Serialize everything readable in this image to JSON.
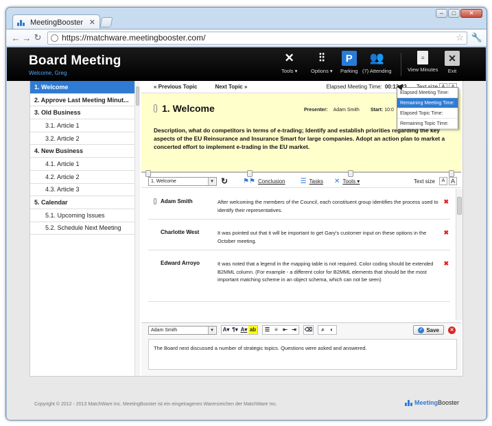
{
  "browser": {
    "tab_title": "MeetingBooster",
    "url": "https://matchware.meetingbooster.com/"
  },
  "app": {
    "title": "Board Meeting",
    "welcome": "Welcome, Greg",
    "toolbar": {
      "tools": "Tools ▾",
      "options": "Options ▾",
      "parking": "Parking",
      "attending": "(7) Attending",
      "view_minutes": "View Minutes",
      "exit": "Exit",
      "parking_glyph": "P"
    }
  },
  "agenda": [
    {
      "label": "1. Welcome",
      "level": "top",
      "active": true
    },
    {
      "label": "2. Approve Last Meeting Minut...",
      "level": "top"
    },
    {
      "label": "3. Old Business",
      "level": "top"
    },
    {
      "label": "3.1. Article 1",
      "level": "sub"
    },
    {
      "label": "3.2. Article 2",
      "level": "sub"
    },
    {
      "label": "4. New Business",
      "level": "top"
    },
    {
      "label": "4.1. Article 1",
      "level": "sub"
    },
    {
      "label": "4.2. Article 2",
      "level": "sub"
    },
    {
      "label": "4.3. Article 3",
      "level": "sub"
    },
    {
      "label": "5. Calendar",
      "level": "top"
    },
    {
      "label": "5.1. Upcoming Issues",
      "level": "sub"
    },
    {
      "label": "5.2. Schedule Next Meeting",
      "level": "sub"
    }
  ],
  "topnav": {
    "prev": "Previous Topic",
    "next": "Next Topic",
    "elapsed_label": "Elapsed Meeting Time:",
    "elapsed_value": "00:12:33",
    "text_size": "Text size",
    "font_a": "A"
  },
  "timer_menu": [
    {
      "label": "Elapsed Meeting Time:"
    },
    {
      "label": "Remaining Meeting Time:",
      "selected": true
    },
    {
      "label": "Elapsed Topic Time:"
    },
    {
      "label": "Remaining Topic Time:"
    }
  ],
  "topic": {
    "title": "1. Welcome",
    "presenter_label": "Presenter:",
    "presenter": "Adam Smith",
    "start_label": "Start:",
    "start_value": "10:0",
    "description": "Description, what do competitors in terms of e-trading; Identify and establish priorities regarding the key aspects of the EU Reinsurance and Insurance Smart for large companies. Adopt an action plan to market a concerted effort to implement e-trading in the EU market."
  },
  "notesbar": {
    "topic_select": "1. Welcome",
    "conclusion": "Conclusion",
    "tasks": "Tasks",
    "tools": "Tools ▾",
    "text_size": "Text size"
  },
  "notes": [
    {
      "name": "Adam Smith",
      "text": "After welcoming the members of the Council, each constituent group identifies the process used to identify their representatives."
    },
    {
      "name": "Charlotte West",
      "text": "It was pointed out that it will be important to get Gary's customer input on these options in the October meeting."
    },
    {
      "name": "Edward Arroyo",
      "text": "It was noted that a legend in the mapping table is not required. Color coding should be extended B2MML column. (For example - a different color for B2MML elements that should be the most important matching scheme in an object schema, which can not be seen)"
    }
  ],
  "editor": {
    "author": "Adam Smith",
    "save": "Save",
    "text": "The Board next discussed a number of strategic topics. Questions were asked and answered."
  },
  "footer": {
    "copyright": "Copyright © 2012 - 2013 MatchWare Inc.     MeetingBooster ist ein eingetragenes Warenzeichen der MatchWare Inc.",
    "logo_meeting": "Meeting",
    "logo_booster": "Booster"
  },
  "colors": {
    "accent": "#2f7bd3",
    "topic_bg": "#ffffcc",
    "header_bg": "#000000"
  }
}
